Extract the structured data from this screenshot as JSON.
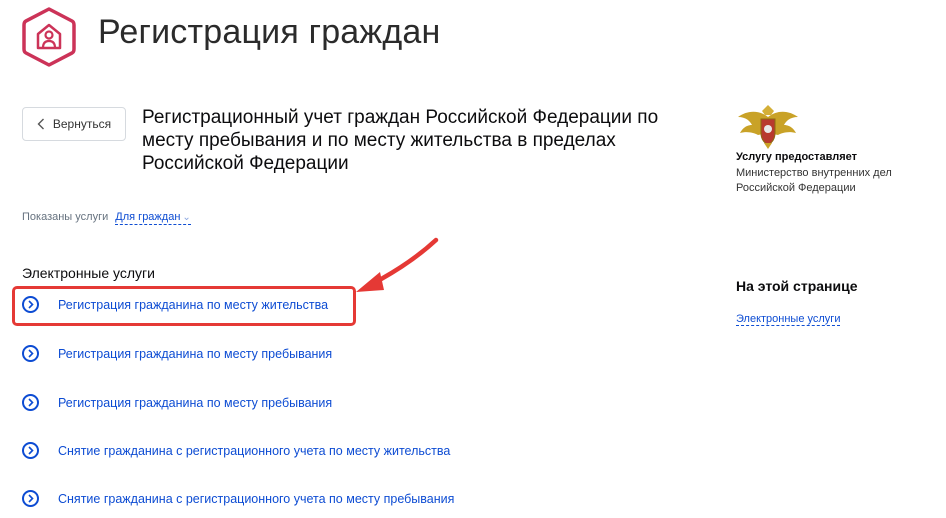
{
  "header": {
    "title": "Регистрация граждан",
    "logo_icon": "house-person-icon",
    "logo_color": "#cc3358"
  },
  "back_button": {
    "label": "Вернуться",
    "icon": "chevron-left-icon"
  },
  "service": {
    "title": "Регистрационный учет граждан Российской Федерации по месту пребывания и по месту жительства в пределах Российской Федерации"
  },
  "filter": {
    "label": "Показаны услуги",
    "selected": "Для граждан"
  },
  "electronic_services": {
    "title": "Электронные услуги",
    "items": [
      {
        "label": "Регистрация гражданина по месту жительства",
        "highlighted": true
      },
      {
        "label": "Регистрация гражданина по месту пребывания"
      },
      {
        "label": "Регистрация гражданина по месту пребывания"
      },
      {
        "label": "Снятие гражданина с регистрационного учета по месту жительства"
      },
      {
        "label": "Снятие гражданина с регистрационного учета по месту пребывания"
      }
    ]
  },
  "provider": {
    "icon": "coat-of-arms-icon",
    "label": "Услугу предоставляет",
    "name": "Министерство внутренних дел\nРоссийской Федерации"
  },
  "on_this_page": {
    "title": "На этой странице",
    "link": "Электронные услуги"
  },
  "colors": {
    "link": "#0d4cd3",
    "highlight": "#e53935",
    "brand": "#cc3358"
  }
}
